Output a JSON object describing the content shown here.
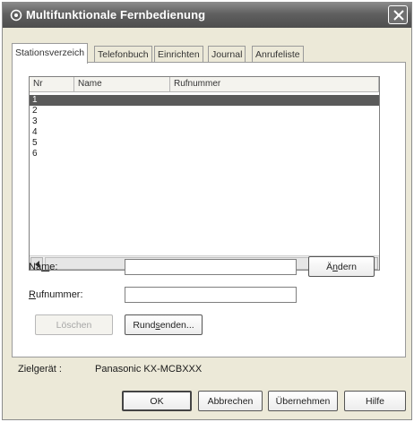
{
  "window": {
    "title": "Multifunktionale Fernbedienung",
    "close_label": "X"
  },
  "tabs": [
    {
      "label": "Stationsverzeich",
      "active": true
    },
    {
      "label": "Telefonbuch",
      "active": false
    },
    {
      "label": "Einrichten",
      "active": false
    },
    {
      "label": "Journal",
      "active": false
    },
    {
      "label": "Anrufeliste",
      "active": false
    }
  ],
  "list": {
    "columns": [
      "Nr",
      "Name",
      "Rufnummer"
    ],
    "rows": [
      "1",
      "2",
      "3",
      "4",
      "5",
      "6"
    ],
    "selected_index": 0
  },
  "form": {
    "name_label_pre": "Na",
    "name_label_ul": "m",
    "name_label_post": "e:",
    "name_value": "",
    "number_label_ul": "R",
    "number_label_post": "ufnummer:",
    "number_value": "",
    "change_pre": "Ä",
    "change_ul": "n",
    "change_post": "dern",
    "delete_label": "Löschen",
    "broadcast_pre": "Rund",
    "broadcast_ul": "s",
    "broadcast_post": "enden..."
  },
  "target": {
    "label": "Zielgerät :",
    "value": "Panasonic KX-MCBXXX"
  },
  "footer": {
    "ok_label": "OK",
    "cancel_label": "Abbrechen",
    "apply_label": "Übernehmen",
    "help_label": "Hilfe"
  },
  "colors": {
    "titlebar": "#5f5f5f",
    "selection": "#5a5a5a",
    "dialog_bg": "#ece9d8"
  }
}
